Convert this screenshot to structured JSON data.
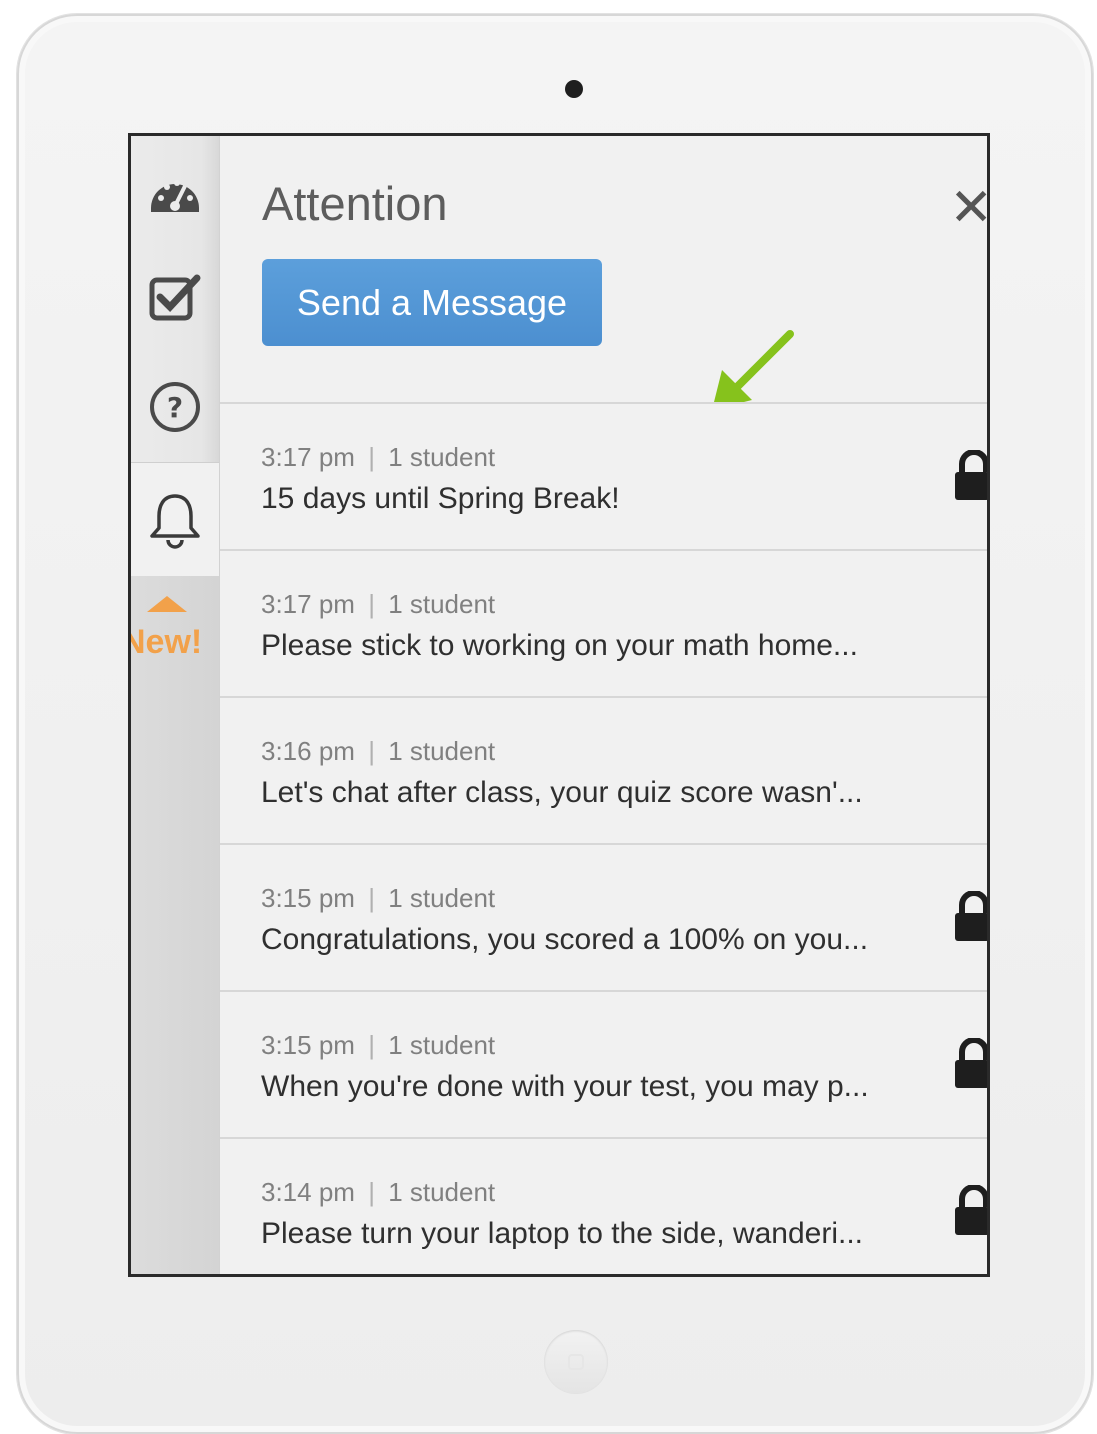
{
  "panel": {
    "title": "Attention",
    "send_button_label": "Send a Message",
    "close_glyph": "✕"
  },
  "sidebar": {
    "items": [
      {
        "icon": "dashboard-icon"
      },
      {
        "icon": "checklist-icon"
      },
      {
        "icon": "help-icon"
      },
      {
        "icon": "bell-icon",
        "active": true
      }
    ],
    "new_badge": "New!"
  },
  "messages": [
    {
      "time": "3:17 pm",
      "recipients": "1 student",
      "text": "15 days until Spring Break!",
      "locked": true
    },
    {
      "time": "3:17 pm",
      "recipients": "1 student",
      "text": "Please stick to working on your math home...",
      "locked": false
    },
    {
      "time": "3:16 pm",
      "recipients": "1 student",
      "text": "Let's chat after class, your quiz score wasn'...",
      "locked": false
    },
    {
      "time": "3:15 pm",
      "recipients": "1 student",
      "text": "Congratulations, you scored a 100% on you...",
      "locked": true
    },
    {
      "time": "3:15 pm",
      "recipients": "1 student",
      "text": "When you're done with your test, you may p...",
      "locked": true
    },
    {
      "time": "3:14 pm",
      "recipients": "1 student",
      "text": "Please turn your laptop to the side, wanderi...",
      "locked": true
    }
  ],
  "meta_separator": "|",
  "colors": {
    "accent": "#4c8fd0",
    "new_badge": "#f2a14a",
    "annotation_arrow": "#86c21c"
  }
}
